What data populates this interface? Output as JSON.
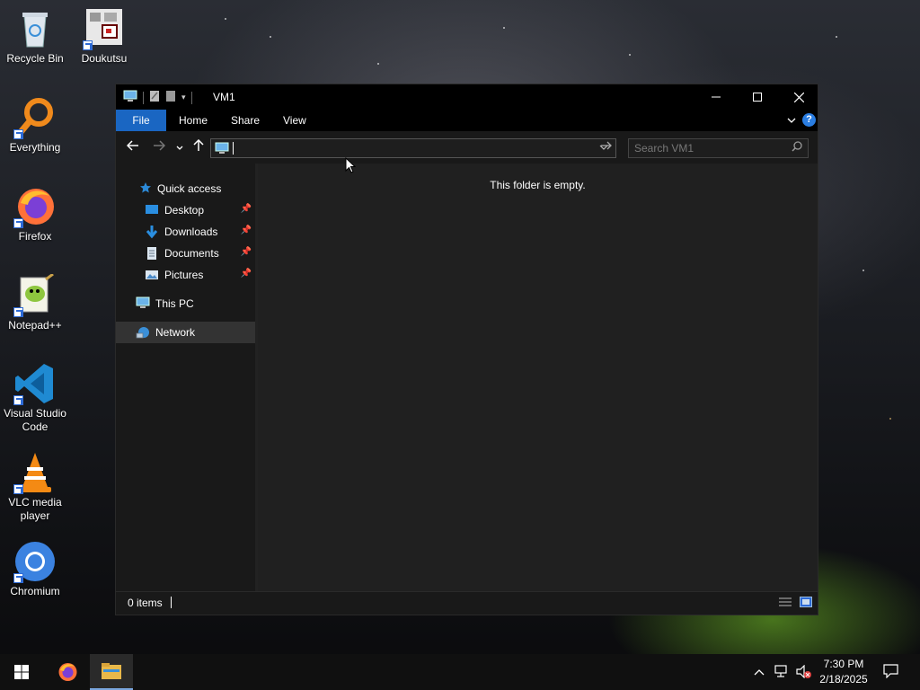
{
  "desktop": {
    "icons": [
      {
        "label": "Recycle Bin",
        "icon": "recycle-bin-icon"
      },
      {
        "label": "Doukutsu",
        "icon": "doukutsu-icon"
      },
      {
        "label": "Everything",
        "icon": "everything-icon"
      },
      {
        "label": "Firefox",
        "icon": "firefox-icon"
      },
      {
        "label": "Notepad++",
        "icon": "notepadpp-icon"
      },
      {
        "label": "Visual Studio Code",
        "icon": "vscode-icon"
      },
      {
        "label": "VLC media player",
        "icon": "vlc-icon"
      },
      {
        "label": "Chromium",
        "icon": "chromium-icon"
      }
    ]
  },
  "window": {
    "title": "VM1",
    "ribbon_tabs": [
      "File",
      "Home",
      "Share",
      "View"
    ],
    "address_value": "",
    "search_placeholder": "Search VM1",
    "nav": {
      "quick_access": "Quick access",
      "pinned": [
        "Desktop",
        "Downloads",
        "Documents",
        "Pictures"
      ],
      "this_pc": "This PC",
      "network": "Network"
    },
    "empty_message": "This folder is empty.",
    "status_count": "0 items"
  },
  "taskbar": {
    "time": "7:30 PM",
    "date": "2/18/2025"
  },
  "colors": {
    "accent": "#1a66c2",
    "window_bg": "#191919",
    "content_bg": "#202020",
    "selected_nav": "#333333"
  }
}
